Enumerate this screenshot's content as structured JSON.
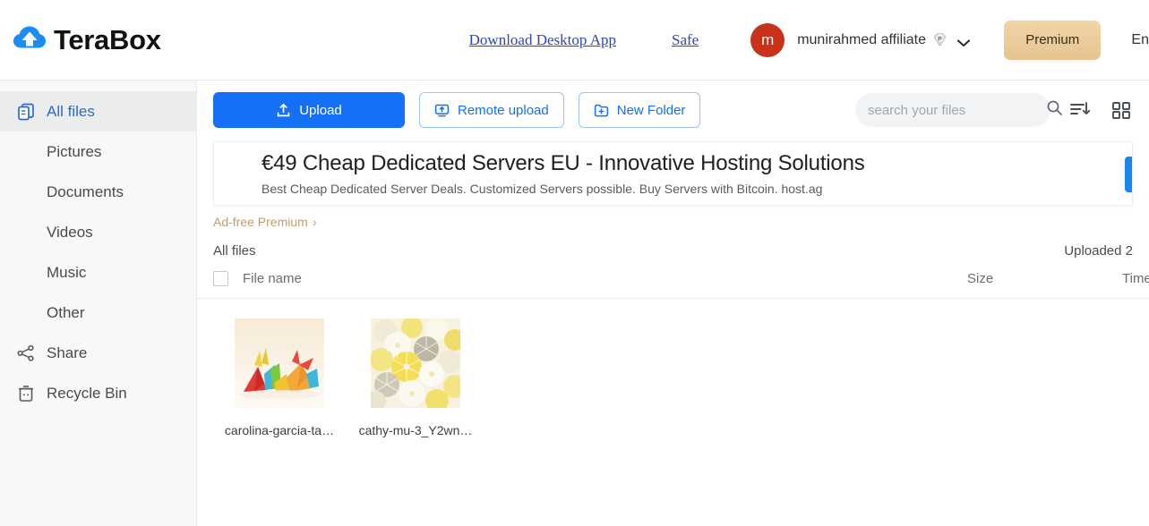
{
  "header": {
    "brand": "TeraBox",
    "brand_logo_icon": "cloud-logo-icon",
    "links": [
      {
        "label": "Download Desktop App",
        "name": "download-desktop-app-link"
      },
      {
        "label": "Safe",
        "name": "safe-link"
      }
    ],
    "user": {
      "avatar_letter": "m",
      "name": "munirahmed affiliate",
      "badge_letter": "P",
      "avatar_color": "#c8321a"
    },
    "premium_label": "Premium",
    "language_label": "En"
  },
  "sidebar": {
    "items": [
      {
        "label": "All files",
        "icon": "files-stack-icon",
        "active": true,
        "sub": false,
        "name": "sidebar-item-all-files"
      },
      {
        "label": "Pictures",
        "icon": "",
        "active": false,
        "sub": true,
        "name": "sidebar-item-pictures"
      },
      {
        "label": "Documents",
        "icon": "",
        "active": false,
        "sub": true,
        "name": "sidebar-item-documents"
      },
      {
        "label": "Videos",
        "icon": "",
        "active": false,
        "sub": true,
        "name": "sidebar-item-videos"
      },
      {
        "label": "Music",
        "icon": "",
        "active": false,
        "sub": true,
        "name": "sidebar-item-music"
      },
      {
        "label": "Other",
        "icon": "",
        "active": false,
        "sub": true,
        "name": "sidebar-item-other"
      },
      {
        "label": "Share",
        "icon": "share-icon",
        "active": false,
        "sub": false,
        "name": "sidebar-item-share"
      },
      {
        "label": "Recycle Bin",
        "icon": "trash-icon",
        "active": false,
        "sub": false,
        "name": "sidebar-item-recycle-bin"
      }
    ]
  },
  "toolbar": {
    "upload_label": "Upload",
    "remote_upload_label": "Remote upload",
    "new_folder_label": "New Folder",
    "search_placeholder": "search your files",
    "search_value": "",
    "search_icon": "search-icon",
    "sort_icon": "sort-descending-icon",
    "view_icon": "grid-view-icon"
  },
  "ad": {
    "title": "€49 Cheap Dedicated Servers EU - Innovative Hosting Solutions",
    "subtitle": "Best Cheap Dedicated Server Deals. Customized Servers possible. Buy Servers with Bitcoin. host.ag",
    "ad_free_label": "Ad-free Premium",
    "ad_free_chevron": "›",
    "accent_color": "#c29d6b"
  },
  "file_list": {
    "breadcrumb": "All files",
    "uploaded_label": "Uploaded 2",
    "columns": {
      "name": "File name",
      "size": "Size",
      "time": "Time",
      "sort_arrow": "↓"
    },
    "files": [
      {
        "label": "carolina-garcia-ta…",
        "thumb": "origami-cranes-thumbnail",
        "name": "file-card-carolina-garcia"
      },
      {
        "label": "cathy-mu-3_Y2wn…",
        "thumb": "paper-fans-thumbnail",
        "name": "file-card-cathy-mu"
      }
    ]
  }
}
